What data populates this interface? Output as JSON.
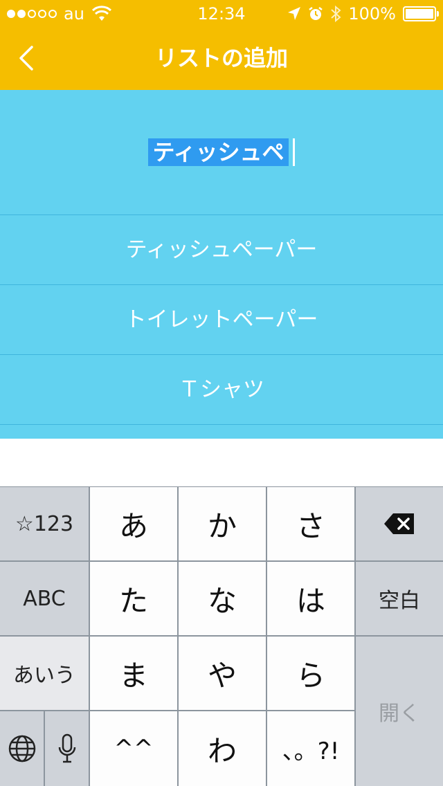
{
  "status_bar": {
    "carrier": "au",
    "time": "12:34",
    "battery": "100%",
    "battery_level": 1.0,
    "signal_dots_filled": 2,
    "signal_dots_total": 5
  },
  "nav": {
    "title": "リストの追加",
    "back_icon": "chevron-left-icon",
    "color": "#f5be00"
  },
  "input": {
    "value": "ティッシュペ"
  },
  "suggestions": [
    {
      "label": "ティッシュペーパー"
    },
    {
      "label": "トイレットペーパー"
    },
    {
      "label": "Ｔシャツ"
    }
  ],
  "keyboard": {
    "left_keys": [
      "☆123",
      "ABC",
      "あいう"
    ],
    "kana_keys": [
      "あ",
      "か",
      "さ",
      "た",
      "な",
      "は",
      "ま",
      "や",
      "ら",
      "^^",
      "わ",
      "、。?!"
    ],
    "right_keys": {
      "backspace_icon": "backspace-icon",
      "space": "空白",
      "enter": "開く"
    },
    "globe_icon": "globe-icon",
    "mic_icon": "microphone-icon"
  },
  "colors": {
    "accent": "#f5be00",
    "list_background": "#62d2f0",
    "selection": "#2f9bf0"
  }
}
